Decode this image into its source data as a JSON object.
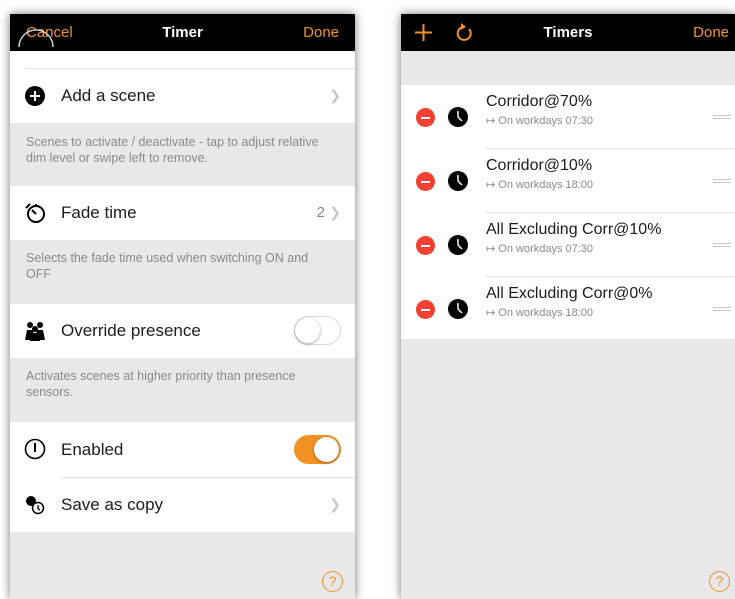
{
  "left": {
    "nav": {
      "cancel": "Cancel",
      "title": "Timer",
      "done": "Done"
    },
    "add_scene": {
      "label": "Add a scene",
      "icon": "plus-circle-icon"
    },
    "scene_help": "Scenes to activate / deactivate - tap to adjust relative dim level or swipe left to remove.",
    "fade_time": {
      "label": "Fade time",
      "value": "2",
      "icon": "timer-icon"
    },
    "fade_help": "Selects the fade time used when switching ON and OFF",
    "override": {
      "label": "Override presence",
      "enabled": false,
      "icon": "people-icon"
    },
    "override_help": "Activates scenes at higher priority than presence sensors.",
    "enabled": {
      "label": "Enabled",
      "enabled": true,
      "icon": "info-circle-icon"
    },
    "save_copy": {
      "label": "Save as copy",
      "icon": "copy-icon"
    },
    "help": "?"
  },
  "right": {
    "nav": {
      "title": "Timers",
      "done": "Done",
      "add_icon": "plus-icon",
      "refresh_icon": "refresh-icon"
    },
    "timers": [
      {
        "name": "Corridor@70%",
        "schedule": "↦ On workdays 07:30"
      },
      {
        "name": "Corridor@10%",
        "schedule": "↦ On workdays 18:00"
      },
      {
        "name": "All Excluding Corr@10%",
        "schedule": "↦ On workdays 07:30"
      },
      {
        "name": "All Excluding Corr@0%",
        "schedule": "↦ On workdays 18:00"
      }
    ],
    "help": "?"
  },
  "colors": {
    "accent": "#f39224",
    "delete": "#f24033",
    "navbar": "#000000",
    "group_bg": "#e8e8ea"
  }
}
